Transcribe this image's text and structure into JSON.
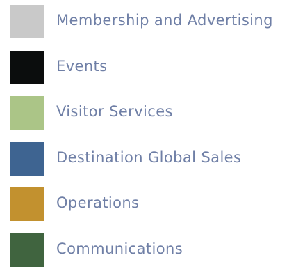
{
  "chart_data": {
    "type": "pie",
    "legend": [
      {
        "label": "Membership and Advertising",
        "color": "#c9c9c9"
      },
      {
        "label": "Events",
        "color": "#0b0d0d"
      },
      {
        "label": "Visitor Services",
        "color": "#abc587"
      },
      {
        "label": "Destination Global Sales",
        "color": "#3e6491"
      },
      {
        "label": "Operations",
        "color": "#c2912f"
      },
      {
        "label": "Communications",
        "color": "#40643f"
      }
    ]
  }
}
